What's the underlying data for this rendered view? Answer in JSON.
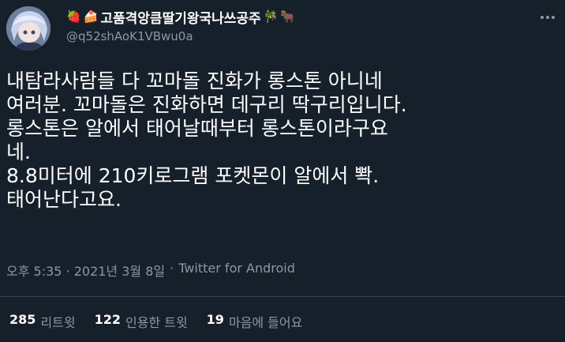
{
  "author": {
    "display_name": "고품격앙큼딸기왕국나쓰공주",
    "name_prefix_emojis": [
      "🍓",
      "🍰"
    ],
    "name_suffix_emojis": [
      "🎋",
      "🐂"
    ],
    "handle": "@q52shAoK1VBwu0a"
  },
  "tweet": {
    "lines": [
      "내탐라사람들 다 꼬마돌 진화가 롱스톤 아니네",
      "여러분. 꼬마돌은 진화하면 데구리 딱구리입니다.",
      "롱스톤은 알에서 태어날때부터 롱스톤이라구요",
      "네.",
      "8.8미터에 210키로그램 포켓몬이 알에서 뽝.",
      "태어난다고요."
    ]
  },
  "meta": {
    "timestamp": "오후 5:35 · 2021년 3월 8일",
    "separator": "·",
    "source": "Twitter for Android"
  },
  "stats": {
    "retweets": {
      "count": "285",
      "label": "리트윗"
    },
    "quotes": {
      "count": "122",
      "label": "인용한 트윗"
    },
    "likes": {
      "count": "19",
      "label": "마음에 들어요"
    }
  },
  "colors": {
    "background": "#15202b",
    "secondary_text": "#8899a6",
    "divider": "#38444d"
  },
  "icons": {
    "more": "more-horizontal-icon",
    "avatar": "anime-character-avatar"
  }
}
